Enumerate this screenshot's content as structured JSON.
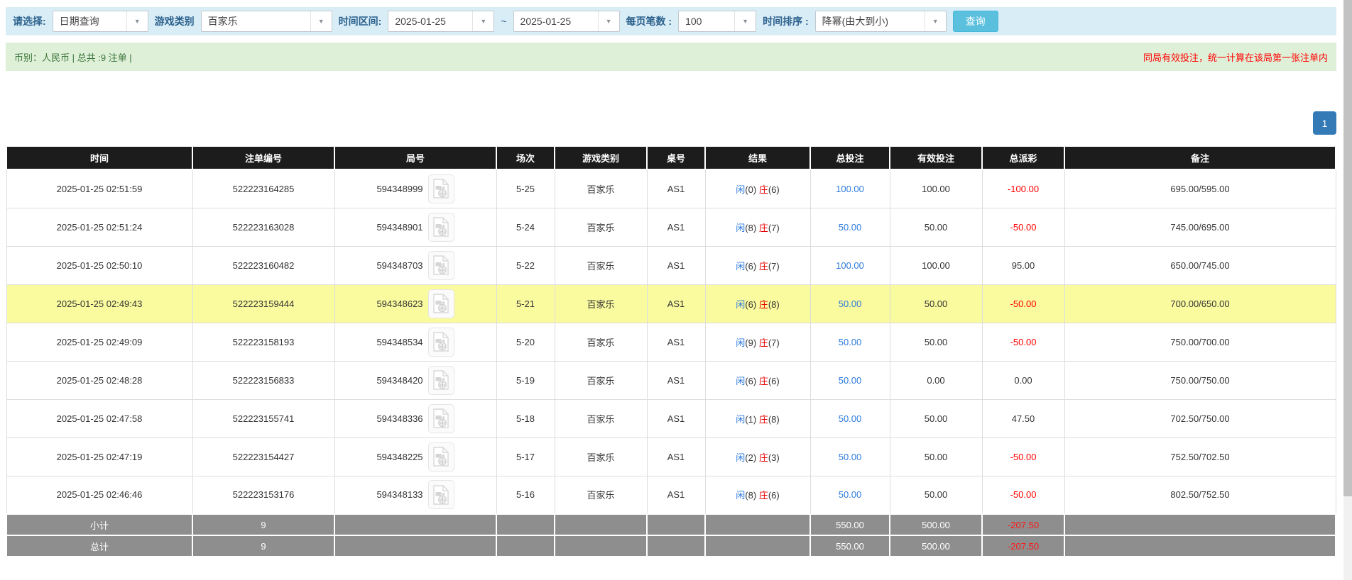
{
  "colors": {
    "filter_bar_bg": "#d9edf7",
    "search_button": "#5bc0de",
    "info_bar_bg": "#dff0d8",
    "info_text_green": "#3c763d",
    "notice_red": "#ff0000",
    "pagination_blue": "#337ab7",
    "table_header_bg": "#1c1c1c",
    "highlight_row_yellow": "#fafa9e",
    "summary_row_gray": "#8e8e8e",
    "link_blue": "#2e7bdd",
    "banker_red": "#e60000",
    "negative_red": "#ff0000"
  },
  "filter_bar": {
    "select_label": "请选择:",
    "select_value": "日期查询",
    "game_label": "游戏类别",
    "game_value": "百家乐",
    "range_label": "时间区间:",
    "range_from": "2025-01-25",
    "range_tilde": "~",
    "range_to": "2025-01-25",
    "pagesize_label": "每页笔数 :",
    "pagesize_value": "100",
    "sort_label": "时间排序 :",
    "sort_value": "降幂(由大到小)",
    "search_label": "查询"
  },
  "info_bar": {
    "summary": "币别：人民币 | 总共 :9 注单 |",
    "notice": "同局有效投注，统一计算在该局第一张注单内"
  },
  "pagination": {
    "current_page": "1"
  },
  "table": {
    "headers": [
      "时间",
      "注单编号",
      "局号",
      "场次",
      "游戏类别",
      "桌号",
      "结果",
      "总投注",
      "有效投注",
      "总派彩",
      "备注"
    ],
    "rows": [
      {
        "time": "2025-01-25 02:51:59",
        "bet_id": "522223164285",
        "round": "594348999",
        "session": "5-25",
        "game": "百家乐",
        "table_no": "AS1",
        "p_label": "闲",
        "p_score": "(0)",
        "b_label": "庄",
        "b_score": "(6)",
        "total_bet": "100.00",
        "valid_bet": "100.00",
        "payout": "-100.00",
        "remark": "695.00/595.00",
        "highlighted": false
      },
      {
        "time": "2025-01-25 02:51:24",
        "bet_id": "522223163028",
        "round": "594348901",
        "session": "5-24",
        "game": "百家乐",
        "table_no": "AS1",
        "p_label": "闲",
        "p_score": "(8)",
        "b_label": "庄",
        "b_score": "(7)",
        "total_bet": "50.00",
        "valid_bet": "50.00",
        "payout": "-50.00",
        "remark": "745.00/695.00",
        "highlighted": false
      },
      {
        "time": "2025-01-25 02:50:10",
        "bet_id": "522223160482",
        "round": "594348703",
        "session": "5-22",
        "game": "百家乐",
        "table_no": "AS1",
        "p_label": "闲",
        "p_score": "(6)",
        "b_label": "庄",
        "b_score": "(7)",
        "total_bet": "100.00",
        "valid_bet": "100.00",
        "payout": "95.00",
        "remark": "650.00/745.00",
        "highlighted": false
      },
      {
        "time": "2025-01-25 02:49:43",
        "bet_id": "522223159444",
        "round": "594348623",
        "session": "5-21",
        "game": "百家乐",
        "table_no": "AS1",
        "p_label": "闲",
        "p_score": "(6)",
        "b_label": "庄",
        "b_score": "(8)",
        "total_bet": "50.00",
        "valid_bet": "50.00",
        "payout": "-50.00",
        "remark": "700.00/650.00",
        "highlighted": true
      },
      {
        "time": "2025-01-25 02:49:09",
        "bet_id": "522223158193",
        "round": "594348534",
        "session": "5-20",
        "game": "百家乐",
        "table_no": "AS1",
        "p_label": "闲",
        "p_score": "(9)",
        "b_label": "庄",
        "b_score": "(7)",
        "total_bet": "50.00",
        "valid_bet": "50.00",
        "payout": "-50.00",
        "remark": "750.00/700.00",
        "highlighted": false
      },
      {
        "time": "2025-01-25 02:48:28",
        "bet_id": "522223156833",
        "round": "594348420",
        "session": "5-19",
        "game": "百家乐",
        "table_no": "AS1",
        "p_label": "闲",
        "p_score": "(6)",
        "b_label": "庄",
        "b_score": "(6)",
        "total_bet": "50.00",
        "valid_bet": "0.00",
        "payout": "0.00",
        "remark": "750.00/750.00",
        "highlighted": false
      },
      {
        "time": "2025-01-25 02:47:58",
        "bet_id": "522223155741",
        "round": "594348336",
        "session": "5-18",
        "game": "百家乐",
        "table_no": "AS1",
        "p_label": "闲",
        "p_score": "(1)",
        "b_label": "庄",
        "b_score": "(8)",
        "total_bet": "50.00",
        "valid_bet": "50.00",
        "payout": "47.50",
        "remark": "702.50/750.00",
        "highlighted": false
      },
      {
        "time": "2025-01-25 02:47:19",
        "bet_id": "522223154427",
        "round": "594348225",
        "session": "5-17",
        "game": "百家乐",
        "table_no": "AS1",
        "p_label": "闲",
        "p_score": "(2)",
        "b_label": "庄",
        "b_score": "(3)",
        "total_bet": "50.00",
        "valid_bet": "50.00",
        "payout": "-50.00",
        "remark": "752.50/702.50",
        "highlighted": false
      },
      {
        "time": "2025-01-25 02:46:46",
        "bet_id": "522223153176",
        "round": "594348133",
        "session": "5-16",
        "game": "百家乐",
        "table_no": "AS1",
        "p_label": "闲",
        "p_score": "(8)",
        "b_label": "庄",
        "b_score": "(6)",
        "total_bet": "50.00",
        "valid_bet": "50.00",
        "payout": "-50.00",
        "remark": "802.50/752.50",
        "highlighted": false
      }
    ],
    "subtotal": {
      "label": "小计",
      "count": "9",
      "total_bet": "550.00",
      "valid_bet": "500.00",
      "payout": "-207.50"
    },
    "total": {
      "label": "总计",
      "count": "9",
      "total_bet": "550.00",
      "valid_bet": "500.00",
      "payout": "-207.50"
    }
  }
}
